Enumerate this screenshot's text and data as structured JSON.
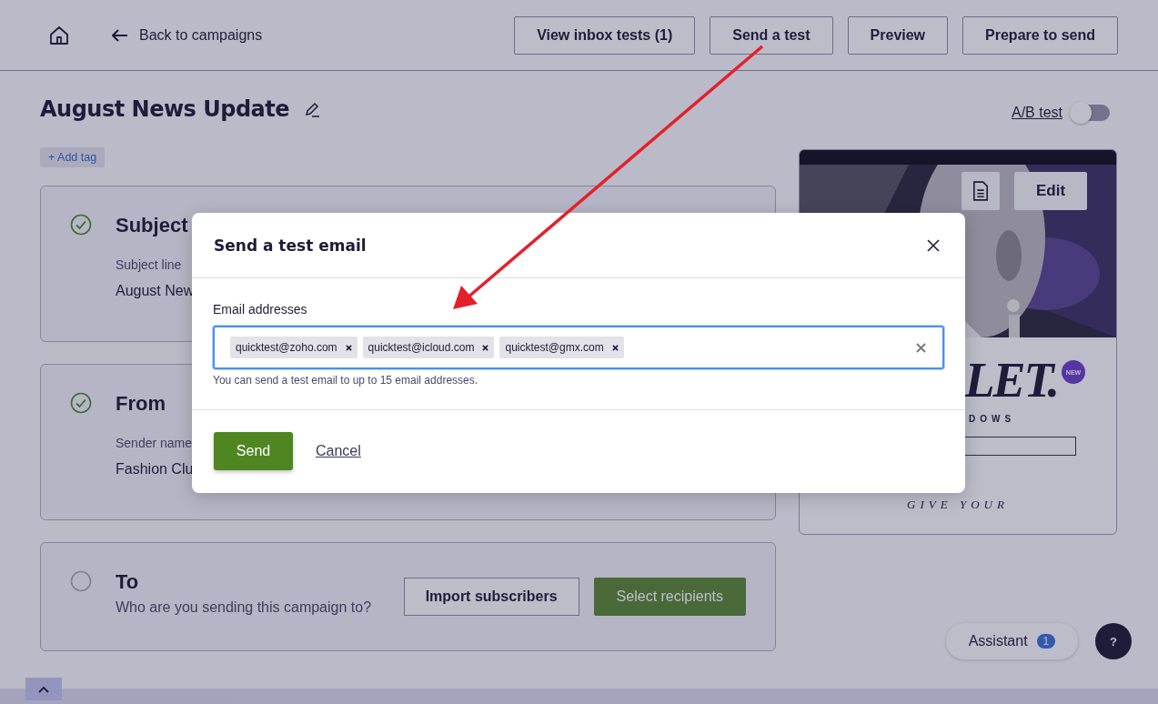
{
  "header": {
    "back_link": "Back to campaigns",
    "buttons": [
      "View inbox tests (1)",
      "Send a test",
      "Preview",
      "Prepare to send"
    ]
  },
  "campaign": {
    "title": "August News Update",
    "add_tag": "+ Add tag",
    "ab_test": {
      "label": "A/B test",
      "on": false
    }
  },
  "sections": [
    {
      "title": "Subject",
      "done": true,
      "field_label": "Subject line",
      "field_value": "August New"
    },
    {
      "title": "From",
      "done": true,
      "field_label": "Sender name",
      "field_value": "Fashion Clu"
    },
    {
      "title": "To",
      "done": false,
      "subtitle": "Who are you sending this campaign to?",
      "buttons": [
        "Import subscribers",
        "Select recipients"
      ]
    }
  ],
  "preview": {
    "edit_button": "Edit",
    "headline": "LET.",
    "badge": "NEW",
    "subline": "DOWS",
    "tagline": "GIVE YOUR"
  },
  "assistant": {
    "label": "Assistant",
    "count": "1"
  },
  "help_button": "?",
  "modal": {
    "title": "Send a test email",
    "field_label": "Email addresses",
    "addresses": [
      "quicktest@zoho.com",
      "quicktest@icloud.com",
      "quicktest@gmx.com"
    ],
    "hint": "You can send a test email to up to 15 email addresses.",
    "send": "Send",
    "cancel": "Cancel"
  }
}
